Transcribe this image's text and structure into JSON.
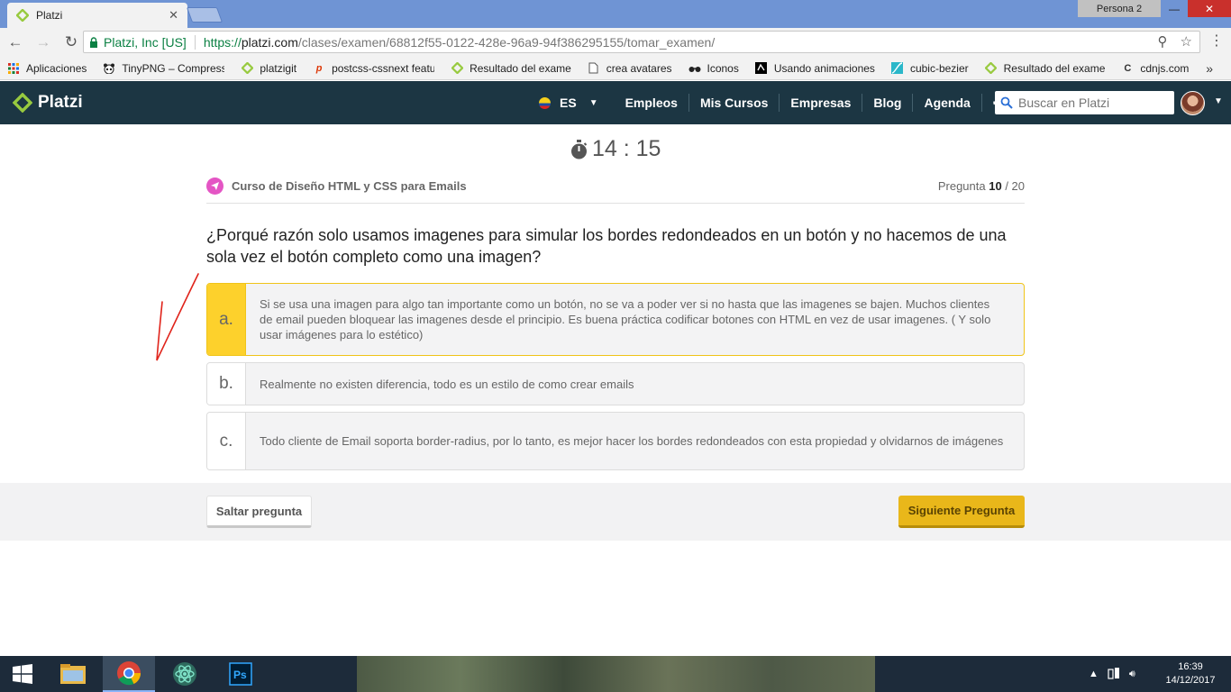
{
  "browser": {
    "tab_title": "Platzi",
    "tab_close": "✕",
    "profile": "Persona 2",
    "win_min": "—",
    "win_max": "❐",
    "win_close": "✕",
    "secure_label": "Platzi, Inc [US]",
    "url_scheme": "https://",
    "url_host": "platzi.com",
    "url_path": "/clases/examen/68812f55-0122-428e-96a9-94f386295155/tomar_examen/",
    "bookmarks": [
      {
        "label": "Aplicaciones",
        "icon": "apps-grid-icon"
      },
      {
        "label": "TinyPNG – Compress",
        "icon": "panda-icon"
      },
      {
        "label": "platzigit",
        "icon": "platzi-icon"
      },
      {
        "label": "postcss-cssnext featu",
        "icon": "postcss-icon"
      },
      {
        "label": "Resultado del exame",
        "icon": "platzi-icon"
      },
      {
        "label": "crea avatares",
        "icon": "page-icon"
      },
      {
        "label": "Iconos",
        "icon": "glasses-icon"
      },
      {
        "label": "Usando animaciones",
        "icon": "mdn-icon"
      },
      {
        "label": "cubic-bezier",
        "icon": "curve-icon"
      },
      {
        "label": "Resultado del exame",
        "icon": "platzi-icon"
      },
      {
        "label": "cdnjs.com",
        "icon": "cdnjs-icon"
      }
    ],
    "bookmarks_more": "»"
  },
  "header": {
    "logo_text": "Platzi",
    "lang": "ES",
    "nav": [
      "Empleos",
      "Mis Cursos",
      "Empresas",
      "Blog",
      "Agenda"
    ],
    "search_placeholder": "Buscar en Platzi"
  },
  "exam": {
    "timer": "14 : 15",
    "course": "Curso de Diseño HTML y CSS para Emails",
    "question_label": "Pregunta",
    "question_current": "10",
    "question_total": " / 20",
    "question": "¿Porqué razón solo usamos imagenes para simular los bordes redondeados en un botón y no hacemos de una sola vez el botón completo como una imagen?",
    "answers": [
      {
        "letter": "a.",
        "text": "Si se usa una imagen para algo tan importante como un botón, no se va a poder ver si no hasta que las imagenes se bajen. Muchos clientes de email pueden bloquear las imagenes desde el principio. Es buena práctica codificar botones con HTML en vez de usar imagenes. ( Y solo usar imágenes para lo estético)",
        "selected": true
      },
      {
        "letter": "b.",
        "text": "Realmente no existen diferencia, todo es un estilo de como crear emails",
        "selected": false
      },
      {
        "letter": "c.",
        "text": "Todo cliente de Email soporta border-radius, por lo tanto, es mejor hacer los bordes redondeados con esta propiedad y olvidarnos de imágenes",
        "selected": false
      }
    ],
    "skip_label": "Saltar pregunta",
    "next_label": "Siguiente Pregunta"
  },
  "taskbar": {
    "time": "16:39",
    "date": "14/12/2017"
  },
  "colors": {
    "header_bg": "#1c3643",
    "selected_answer": "#fdd12c",
    "next_button": "#e9b71a",
    "platzi_green": "#98ca3f"
  }
}
